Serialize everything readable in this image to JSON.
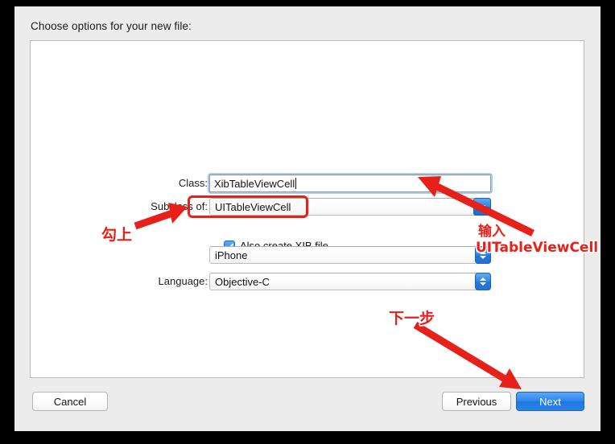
{
  "dialog": {
    "title": "Choose options for your new file:"
  },
  "form": {
    "class_label": "Class:",
    "class_value": "XibTableViewCell",
    "subclass_label": "Subclass of:",
    "subclass_value": "UITableViewCell",
    "checkbox_label": "Also create XIB file",
    "checkbox_checked": "checked",
    "device_value": "iPhone",
    "language_label": "Language:",
    "language_value": "Objective-C"
  },
  "buttons": {
    "cancel": "Cancel",
    "previous": "Previous",
    "next": "Next"
  },
  "annotations": {
    "check_it": "勾上",
    "input": "输入",
    "input_value": "UITableViewCell",
    "next_step": "下一步"
  },
  "colors": {
    "accent_blue": "#2d88ec",
    "annotation_red": "#e8201a",
    "focus_ring": "#a8ccf0",
    "dialog_bg": "#ececec",
    "panel_bg": "#ffffff"
  },
  "icons": {
    "chevron_down": "chevron-down-icon",
    "stepper": "stepper-updown-icon",
    "checkmark": "checkmark-icon"
  }
}
